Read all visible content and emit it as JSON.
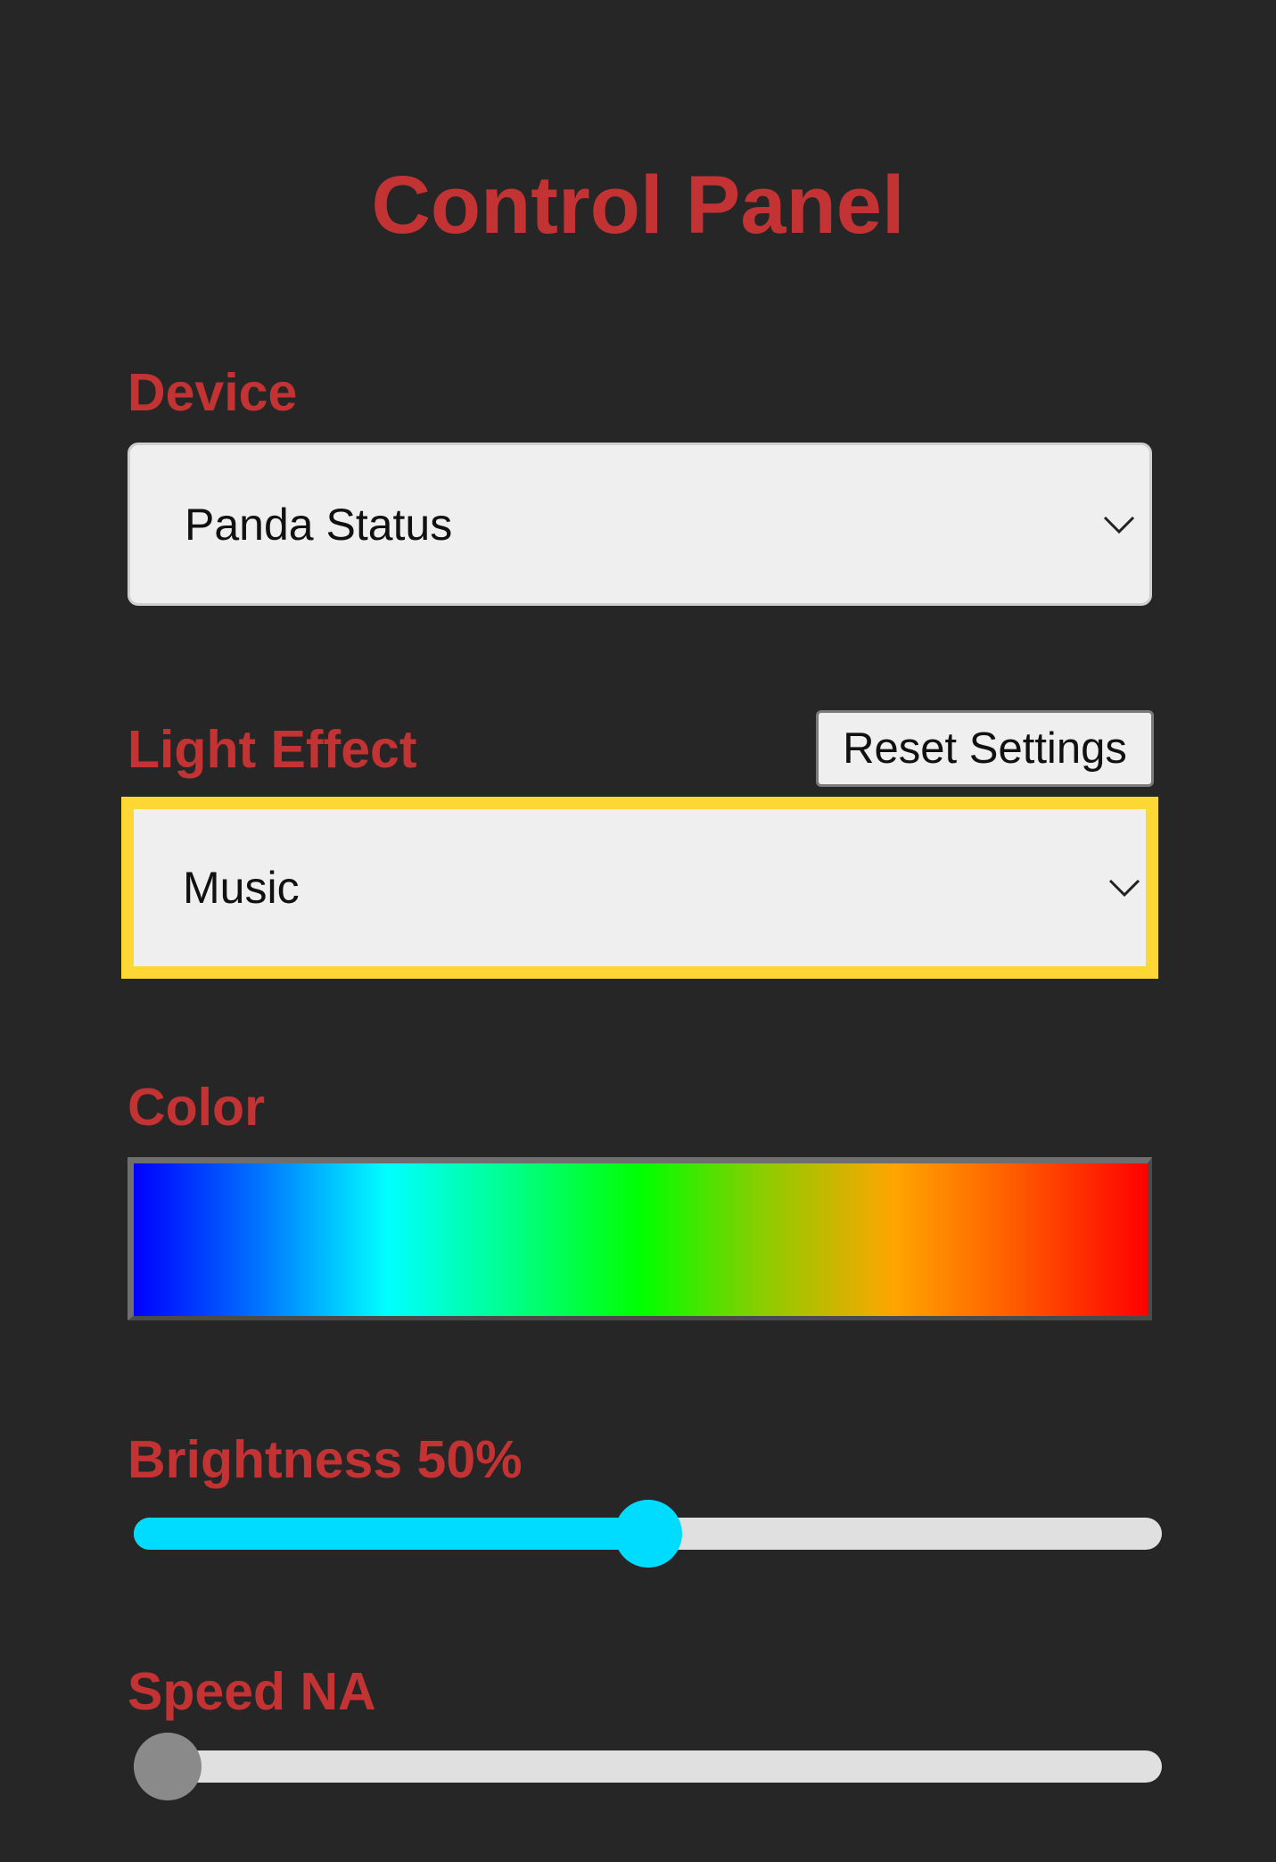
{
  "title": "Control Panel",
  "device": {
    "label": "Device",
    "selected": "Panda Status"
  },
  "light_effect": {
    "label": "Light Effect",
    "selected": "Music",
    "reset_label": "Reset Settings"
  },
  "color": {
    "label": "Color",
    "gradient_stops": [
      "#0000ff",
      "#00ffff",
      "#00ff00",
      "#ffa500",
      "#ff0000"
    ]
  },
  "brightness": {
    "label": "Brightness 50%",
    "value_fraction": 0.5
  },
  "speed": {
    "label": "Speed NA",
    "value_fraction": 0
  },
  "colors": {
    "background": "#272627",
    "accent_red": "#c43333",
    "focus_yellow": "#fdd835",
    "slider_cyan": "#00dcff",
    "slider_disabled_thumb": "#8a8a8a",
    "track": "#e0e0e0"
  },
  "icons": {
    "dropdown": "chevron-down-icon"
  }
}
